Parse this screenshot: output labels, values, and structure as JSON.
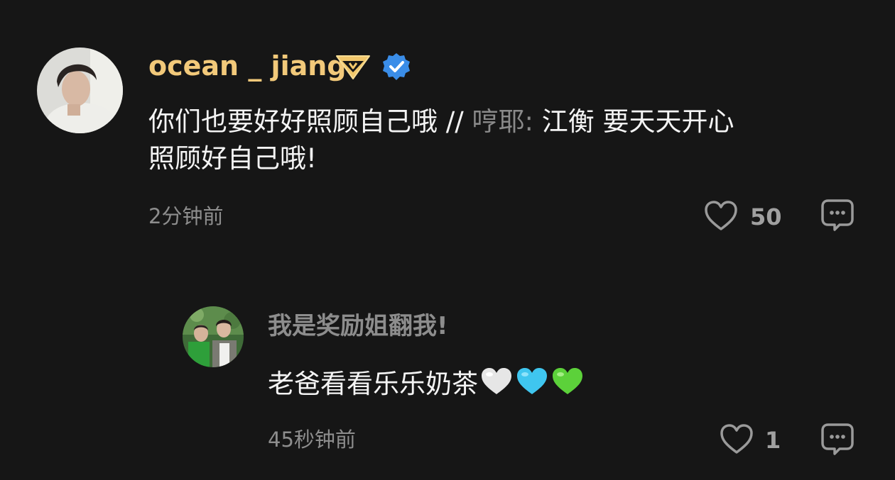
{
  "comment": {
    "username": "ocean _ jiang",
    "text_main": "你们也要好好照顾自己哦 // ",
    "text_quote_name": "哼耶: ",
    "text_quote_line1": "江衡 要天天开心",
    "text_line2": "照顾好自己哦!",
    "time": "2分钟前",
    "likes": "50"
  },
  "reply": {
    "username": "我是奖励姐翻我!",
    "text": "老爸看看乐乐奶茶",
    "time": "45秒钟前",
    "likes": "1",
    "emojis": [
      "white-heart",
      "light-blue-heart",
      "green-heart"
    ]
  },
  "colors": {
    "background": "#161616",
    "username_gold": "#f2c97a",
    "verified_blue": "#3a8de8",
    "muted_text": "#8d8d8d",
    "heart_white": "#e8e8e8",
    "heart_blue": "#3fc6ef",
    "heart_green": "#5cd13a"
  }
}
